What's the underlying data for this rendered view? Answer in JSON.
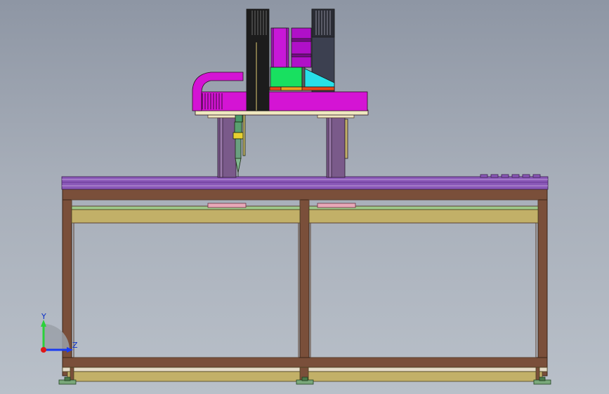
{
  "viewport": {
    "background_top": "#8e96a4",
    "background_bottom": "#b9c0c9"
  },
  "triad": {
    "y_label": "Y",
    "z_label": "Z",
    "y_color": "#2bd13a",
    "z_color": "#1a3cf0",
    "origin_color": "#e01818"
  },
  "colors": {
    "frame": "#7a4f3a",
    "frame_edge": "#3a2418",
    "table_top": "#8a58b8",
    "rail": "#a68cc8",
    "panel_tan": "#c2b068",
    "green_strip": "#9ec98a",
    "pink_pad": "#e8a8b8",
    "magenta": "#d414d4",
    "cyan": "#28e0e8",
    "green_block": "#18e060",
    "black_motor": "#1c1c1c",
    "column": "#7a5a8a",
    "cream": "#f0e8c0"
  }
}
